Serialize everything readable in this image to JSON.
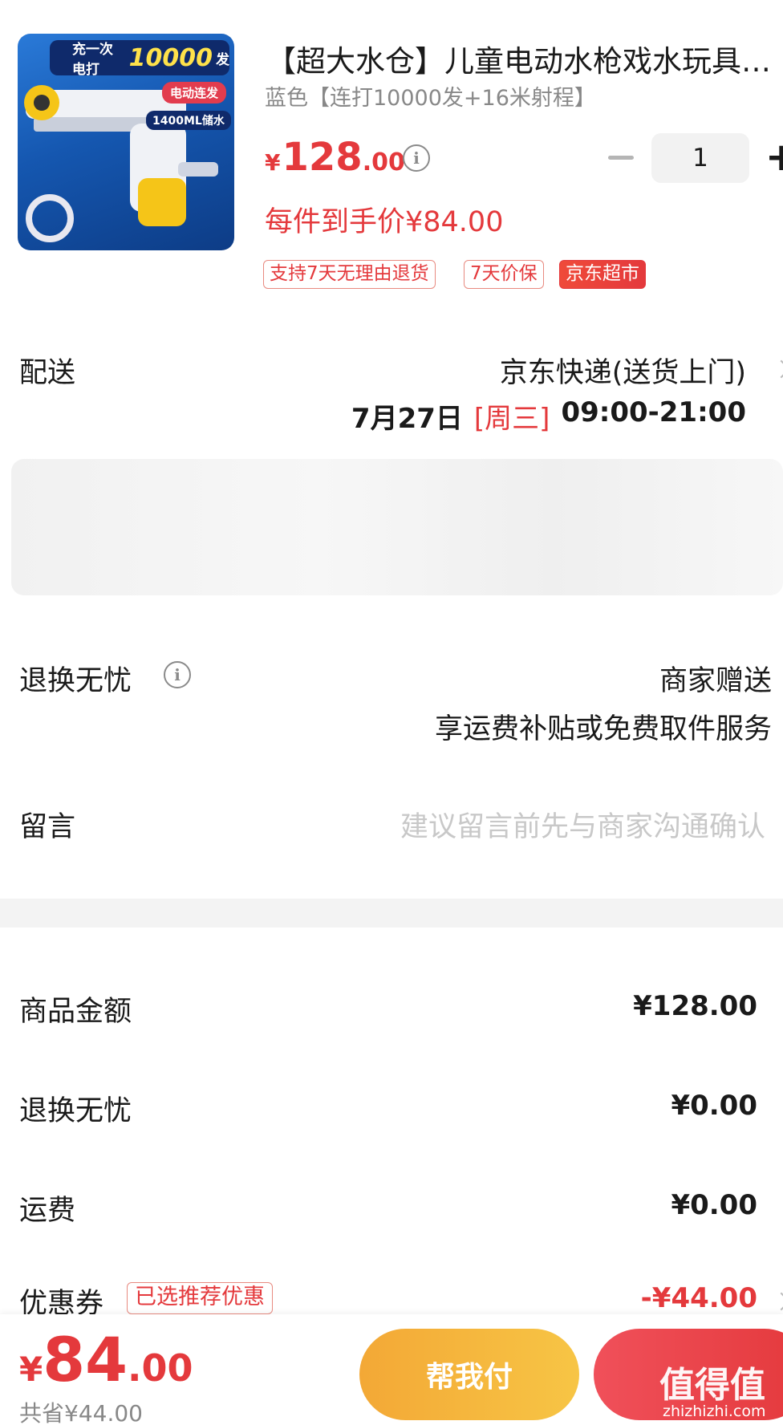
{
  "product": {
    "thumbnail": {
      "banner_prefix": "充一次电打",
      "banner_number": "10000",
      "banner_suffix": "发",
      "pill": "电动连发",
      "capacity": "1400ML储水"
    },
    "title": "【超大水仓】儿童电动水枪戏水玩具…",
    "variant": "蓝色【连打10000发+16米射程】",
    "price_symbol": "¥",
    "price_int": "128",
    "price_dec": ".00",
    "quantity": "1",
    "unit_price": "每件到手价¥84.00",
    "tags": [
      "支持7天无理由退货",
      "7天价保",
      "京东超市"
    ]
  },
  "delivery": {
    "label": "配送",
    "method": "京东快递(送货上门)",
    "date": "7月27日",
    "weekday": "[周三]",
    "time": "09:00-21:00"
  },
  "return_service": {
    "label": "退换无忧",
    "value": "商家赠送",
    "desc": "享运费补贴或免费取件服务"
  },
  "message": {
    "label": "留言",
    "placeholder": "建议留言前先与商家沟通确认"
  },
  "summary": [
    {
      "label": "商品金额",
      "value": "¥128.00"
    },
    {
      "label": "退换无忧",
      "value": "¥0.00"
    },
    {
      "label": "运费",
      "value": "¥0.00"
    }
  ],
  "coupon": {
    "label": "优惠券",
    "tag": "已选推荐优惠",
    "value": "-¥44.00"
  },
  "bottom": {
    "total_symbol": "¥",
    "total_int": "84",
    "total_dec": ".00",
    "saved": "共省¥44.00",
    "help_pay": "帮我付",
    "watermark": "值得值",
    "watermark_url": "zhizhizhi.com"
  },
  "colors": {
    "accent": "#e4393c",
    "help_pay_bg": "#f3a836",
    "muted_text": "#888888"
  }
}
